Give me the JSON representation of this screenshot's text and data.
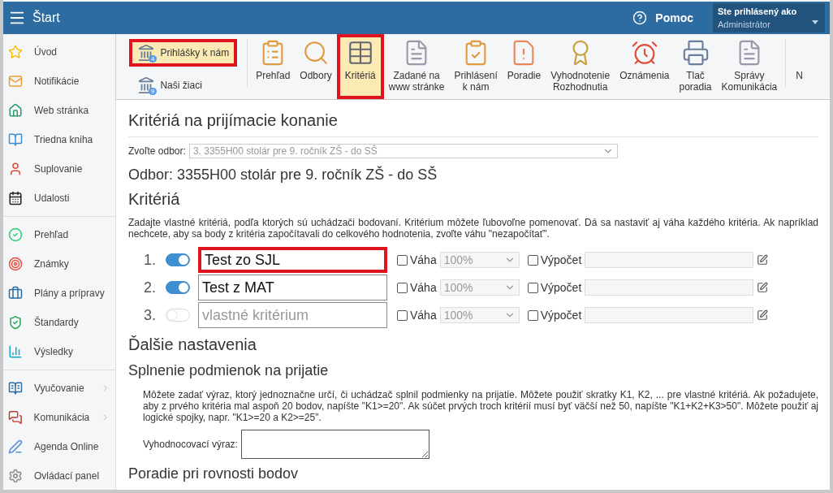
{
  "header": {
    "title": "Štart",
    "help": "Pomoc",
    "user_caption": "Ste prihlásený ako",
    "user_name": "Administrátor"
  },
  "sidebar": {
    "groups": [
      [
        {
          "label": "Úvod",
          "expandable": false
        },
        {
          "label": "Notifikácie",
          "expandable": false
        },
        {
          "label": "Web stránka",
          "expandable": false
        },
        {
          "label": "Triedna kniha",
          "expandable": false
        },
        {
          "label": "Suplovanie",
          "expandable": false
        },
        {
          "label": "Udalosti",
          "expandable": false
        }
      ],
      [
        {
          "label": "Prehľad",
          "expandable": false
        },
        {
          "label": "Známky",
          "expandable": false
        },
        {
          "label": "Plány a prípravy",
          "expandable": false
        },
        {
          "label": "Štandardy",
          "expandable": false
        },
        {
          "label": "Výsledky",
          "expandable": false
        }
      ],
      [
        {
          "label": "Vyučovanie",
          "expandable": true
        },
        {
          "label": "Komunikácia",
          "expandable": true
        },
        {
          "label": "Agenda Online",
          "expandable": false
        },
        {
          "label": "Ovládací panel",
          "expandable": false
        }
      ]
    ]
  },
  "toolbar": {
    "small_items": [
      {
        "label": "Prihlášky k nám",
        "badge": "4",
        "selected": true,
        "highlighted": true
      },
      {
        "label": "Naši žiaci",
        "badge": "9",
        "selected": false,
        "highlighted": false
      }
    ],
    "items": [
      {
        "label": "Prehľad",
        "selected": false,
        "highlighted": false
      },
      {
        "label": "Odbory",
        "selected": false,
        "highlighted": false
      },
      {
        "label": "Kritériá",
        "selected": true,
        "highlighted": true
      },
      {
        "label": "Zadané na\nwww stránke",
        "selected": false,
        "highlighted": false
      },
      {
        "label": "Prihlásení\nk nám",
        "selected": false,
        "highlighted": false
      },
      {
        "label": "Poradie",
        "selected": false,
        "highlighted": false
      },
      {
        "label": "Vyhodnotenie\nRozhodnutia",
        "selected": false,
        "highlighted": false
      },
      {
        "label": "Oznámenia",
        "selected": false,
        "highlighted": false
      },
      {
        "label": "Tlač\nporadia",
        "selected": false,
        "highlighted": false
      },
      {
        "label": "Správy\nKomunikácia",
        "selected": false,
        "highlighted": false
      }
    ],
    "cut_item": "N"
  },
  "page_title": "Kritériá na prijímacie konanie",
  "field_select": {
    "label": "Zvoľte odbor:",
    "value": "3. 3355H00 stolár pre 9. ročník ZŠ - do SŠ"
  },
  "field_heading": "Odbor: 3355H00 stolár pre 9. ročník ZŠ - do SŠ",
  "criteria_heading": "Kritériá",
  "criteria_help": "Zadajte vlastné kritériá, podľa ktorých sú uchádzači bodovaní. Kritérium môžete ľubovoľne pomenovať. Dá sa nastaviť aj váha každého kritéria. Ak napríklad nechcete, aby sa body z kritéria započítavali do celkového hodnotenia, zvoľte váhu \"nezapočítať\".",
  "criteria": [
    {
      "number": "1.",
      "on": true,
      "value": "Test zo SJL",
      "highlighted": true,
      "weight_label": "Váha",
      "weight_checked": false,
      "weight": "100%",
      "calc_label": "Výpočet",
      "calc_checked": false
    },
    {
      "number": "2.",
      "on": true,
      "value": "Test z MAT",
      "highlighted": false,
      "weight_label": "Váha",
      "weight_checked": false,
      "weight": "100%",
      "calc_label": "Výpočet",
      "calc_checked": false
    },
    {
      "number": "3.",
      "on": false,
      "placeholder": "vlastné kritérium",
      "highlighted": false,
      "weight_label": "Váha",
      "weight_checked": false,
      "weight": "100%",
      "calc_label": "Výpočet",
      "calc_checked": false
    }
  ],
  "more_heading": "Ďalšie nastavenia",
  "conditions_heading": "Splnenie podmienok na prijatie",
  "conditions_help": "Môžete zadať výraz, ktorý jednoznačne určí, či uchádzač splnil podmienky na prijatie. Môžete použiť skratky K1, K2, ... pre vlastné kritériá. Ak požadujete, aby z prvého kritéria mal aspoň 20 bodov, napíšte \"K1>=20\". Ak súčet prvých troch kritérií musí byť väčší než 50, napíšte \"K1+K2+K3>50\". Môžete použiť aj logické spojky, napr. \"K1>=20 a K2>=25\".",
  "expression_label": "Vyhodnocovací výraz:",
  "tie_heading": "Poradie pri rovnosti bodov"
}
